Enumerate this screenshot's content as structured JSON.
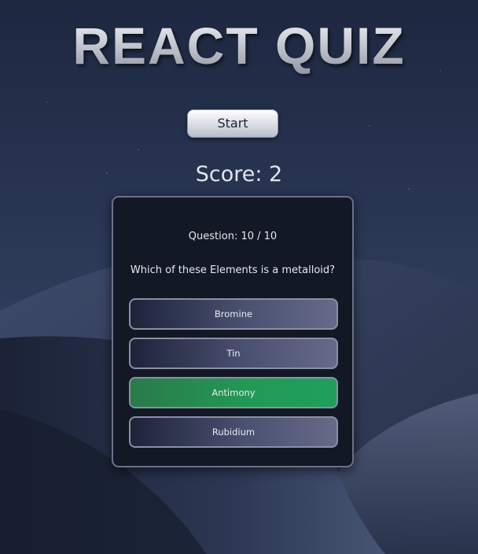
{
  "app": {
    "title": "REACT QUIZ"
  },
  "controls": {
    "start_label": "Start"
  },
  "score": {
    "text": "Score: 2"
  },
  "question": {
    "number_text": "Question: 10 / 10",
    "text": "Which of these Elements is a metalloid?",
    "answers": [
      {
        "label": "Bromine",
        "state": "default"
      },
      {
        "label": "Tin",
        "state": "default"
      },
      {
        "label": "Antimony",
        "state": "correct"
      },
      {
        "label": "Rubidium",
        "state": "default"
      }
    ]
  },
  "colors": {
    "correct": "#1fa05a",
    "card_bg": "#131825",
    "card_border": "#6c7188"
  }
}
